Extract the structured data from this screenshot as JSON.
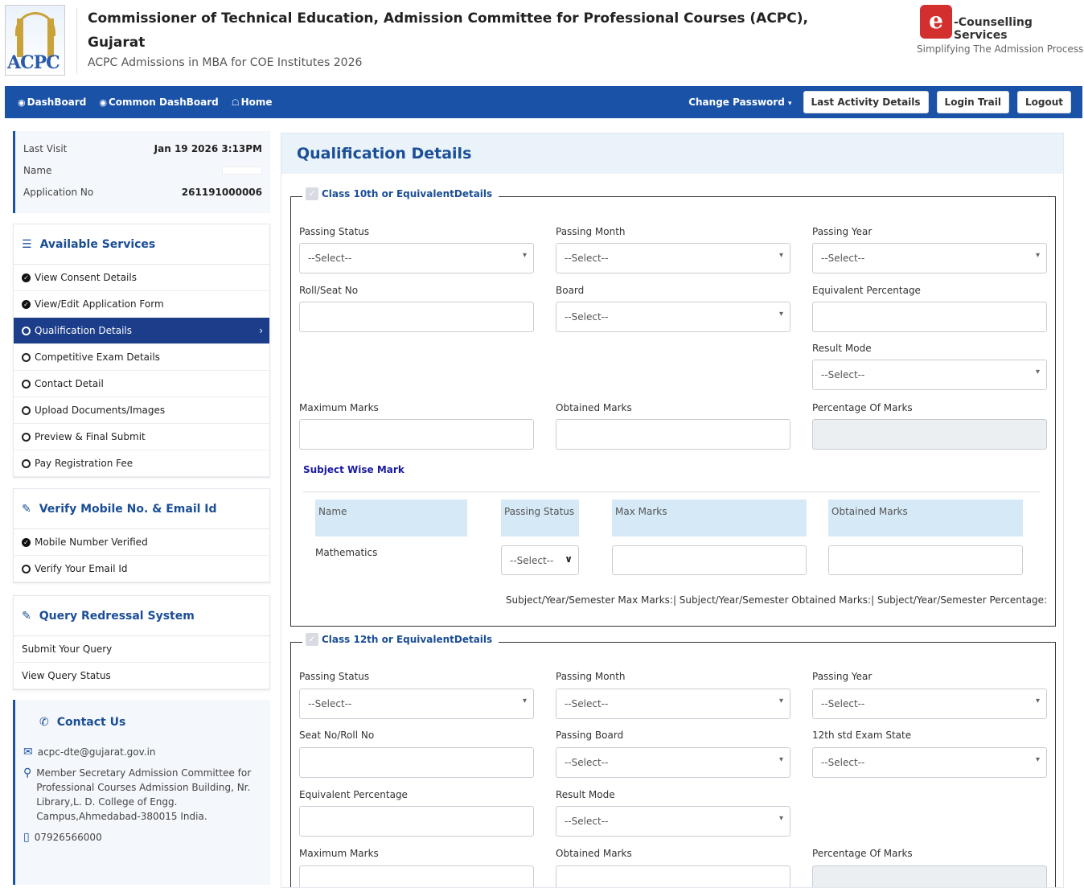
{
  "header": {
    "logo_text": "ACPC",
    "title": "Commissioner of Technical Education, Admission Committee for Professional Courses (ACPC), Gujarat",
    "subtitle": "ACPC Admissions in MBA for COE Institutes 2026",
    "cs_badge": "e",
    "cs_title": "-Counselling Services",
    "cs_sub": "Simplifying The Admission Process"
  },
  "nav": {
    "dashboard": "DashBoard",
    "common_dashboard": "Common DashBoard",
    "home": "Home",
    "change_password": "Change Password",
    "last_activity": "Last Activity Details",
    "login_trail": "Login Trail",
    "logout": "Logout"
  },
  "visit": {
    "last_visit_label": "Last Visit",
    "last_visit_value": "Jan 19 2026 3:13PM",
    "name_label": "Name",
    "app_no_label": "Application No",
    "app_no_value": "261191000006"
  },
  "services": {
    "title": "Available Services",
    "items": [
      {
        "label": "View Consent Details"
      },
      {
        "label": "View/Edit Application Form"
      },
      {
        "label": "Qualification Details"
      },
      {
        "label": "Competitive Exam Details"
      },
      {
        "label": "Contact Detail"
      },
      {
        "label": "Upload Documents/Images"
      },
      {
        "label": "Preview & Final Submit"
      },
      {
        "label": "Pay Registration Fee"
      }
    ]
  },
  "verify": {
    "title": "Verify Mobile No. & Email Id",
    "items": [
      {
        "label": "Mobile Number Verified"
      },
      {
        "label": "Verify Your Email Id"
      }
    ]
  },
  "query": {
    "title": "Query Redressal System",
    "items": [
      {
        "label": "Submit Your Query"
      },
      {
        "label": "View Query Status"
      }
    ]
  },
  "contact": {
    "title": "Contact Us",
    "email": "acpc-dte@gujarat.gov.in",
    "address": "Member Secretary Admission Committee for Professional Courses Admission Building, Nr. Library,L. D. College of Engg. Campus,Ahmedabad-380015 India.",
    "phone": "07926566000"
  },
  "main": {
    "title": "Qualification Details",
    "select_placeholder": "--Select--",
    "class10": {
      "legend": "Class 10th or EquivalentDetails",
      "passing_status": "Passing Status",
      "passing_month": "Passing Month",
      "passing_year": "Passing Year",
      "roll_seat_no": "Roll/Seat No",
      "board": "Board",
      "equivalent_percentage": "Equivalent Percentage",
      "result_mode": "Result Mode",
      "maximum_marks": "Maximum Marks",
      "obtained_marks": "Obtained Marks",
      "percentage_of_marks": "Percentage Of Marks",
      "subject_wise_mark": "Subject Wise Mark",
      "table_headers": [
        "Name",
        "Passing Status",
        "Max Marks",
        "Obtained Marks"
      ],
      "subject_row": "Mathematics",
      "summary": "Subject/Year/Semester Max Marks:| Subject/Year/Semester Obtained Marks:| Subject/Year/Semester Percentage:"
    },
    "class12": {
      "legend": "Class 12th or EquivalentDetails",
      "passing_status": "Passing Status",
      "passing_month": "Passing Month",
      "passing_year": "Passing Year",
      "seat_roll_no": "Seat No/Roll No",
      "passing_board": "Passing Board",
      "exam_state": "12th std Exam State",
      "equivalent_percentage": "Equivalent Percentage",
      "result_mode": "Result Mode",
      "maximum_marks": "Maximum Marks",
      "obtained_marks": "Obtained Marks",
      "percentage_of_marks": "Percentage Of Marks"
    }
  }
}
